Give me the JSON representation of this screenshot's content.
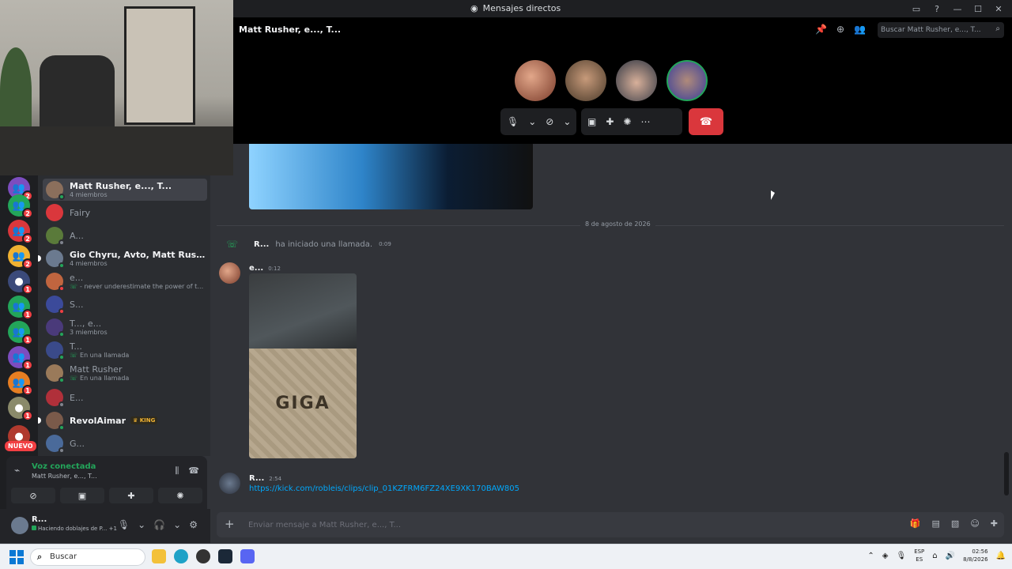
{
  "window": {
    "title": "Mensajes directos"
  },
  "header": {
    "title": "Matt Rusher, e..., T...",
    "search_placeholder": "Buscar Matt Rusher, e..., T..."
  },
  "guild_badges": [
    "2",
    "2",
    "2",
    "2",
    "1",
    "1",
    "1",
    "1",
    "1",
    "1",
    "1"
  ],
  "nuevo_label": "NUEVO",
  "dms": [
    {
      "name": "Matt Rusher, e..., T...",
      "sub": "4 miembros"
    },
    {
      "name": "Fairy",
      "sub": ""
    },
    {
      "name": "A...",
      "sub": ""
    },
    {
      "name": "Gio Chyru, Avto, Matt Rusher",
      "sub": "4 miembros"
    },
    {
      "name": "e...",
      "sub": "- never underestimate the power of the scou..."
    },
    {
      "name": "S...",
      "sub": ""
    },
    {
      "name": "T..., e...",
      "sub": "3 miembros"
    },
    {
      "name": "T...",
      "sub": "En una llamada"
    },
    {
      "name": "Matt Rusher",
      "sub": "En una llamada"
    },
    {
      "name": "E...",
      "sub": ""
    },
    {
      "name": "RevolAimar",
      "sub": "",
      "badge": "KING"
    },
    {
      "name": "G...",
      "sub": ""
    }
  ],
  "voice": {
    "status": "Voz conectada",
    "channel": "Matt Rusher, e..., T..."
  },
  "user": {
    "name": "R...",
    "status": "Haciendo doblajes de P...",
    "extra": "+1"
  },
  "chat": {
    "date_divider": "8 de agosto de 2026",
    "system": {
      "author": "R...",
      "text": "ha iniciado una llamada.",
      "time": "0:09"
    },
    "messages": [
      {
        "author": "e...",
        "time": "0:12",
        "image_text": "GIGA"
      },
      {
        "author": "R...",
        "time": "2:54",
        "link": "https://kick.com/robleis/clips/clip_01KZFRM6FZ24XE9XK170BAW805"
      }
    ],
    "composer_placeholder": "Enviar mensaje a Matt Rusher, e..., T..."
  },
  "taskbar": {
    "search_label": "Buscar",
    "lang_line1": "ESP",
    "lang_line2": "ES",
    "time": "02:56",
    "date": "8/8/2026"
  },
  "colors": {
    "accent_green": "#23a55a",
    "danger": "#da373c",
    "link": "#00a8fc",
    "background": "#313338"
  }
}
